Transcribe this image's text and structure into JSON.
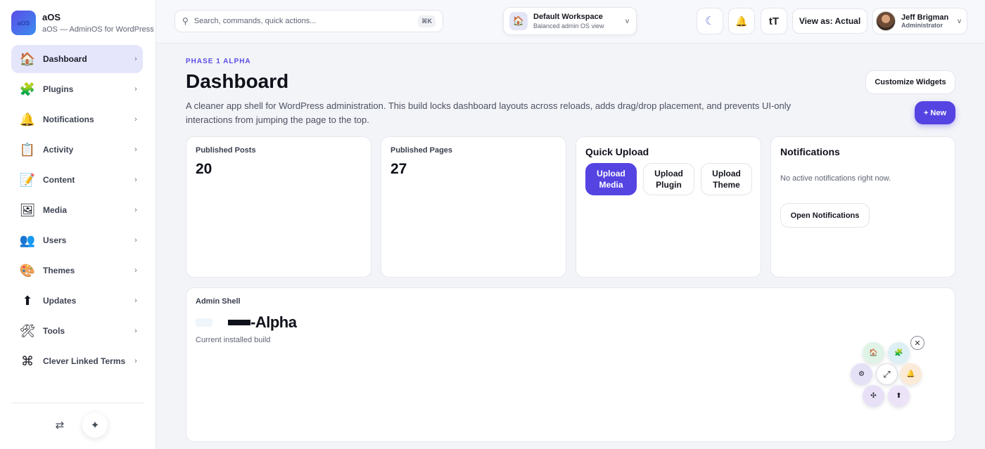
{
  "brand": {
    "logo_text": "aOS",
    "name": "aOS",
    "subtitle": "aOS — AdminOS for WordPress"
  },
  "sidebar": {
    "items": [
      {
        "label": "Dashboard",
        "icon": "🏠",
        "name": "dashboard",
        "active": true
      },
      {
        "label": "Plugins",
        "icon": "🧩",
        "name": "plugins"
      },
      {
        "label": "Notifications",
        "icon": "🔔",
        "name": "notifications"
      },
      {
        "label": "Activity",
        "icon": "📋",
        "name": "activity"
      },
      {
        "label": "Content",
        "icon": "📝",
        "name": "content"
      },
      {
        "label": "Media",
        "icon": "🖼",
        "name": "media"
      },
      {
        "label": "Users",
        "icon": "👥",
        "name": "users"
      },
      {
        "label": "Themes",
        "icon": "🎨",
        "name": "themes"
      },
      {
        "label": "Updates",
        "icon": "⬆",
        "name": "updates"
      },
      {
        "label": "Tools",
        "icon": "🛠",
        "name": "tools"
      },
      {
        "label": "Clever Linked Terms",
        "icon": "⌘",
        "name": "clever-linked-terms"
      }
    ],
    "chevron": "›",
    "footer": {
      "swap_icon": "⇄",
      "sparkle_icon": "✦"
    }
  },
  "topbar": {
    "search_placeholder": "Search, commands, quick actions...",
    "search_icon": "⚲",
    "search_shortcut": "⌘K",
    "workspace": {
      "icon": "🏠",
      "title": "Default Workspace",
      "subtitle": "Balanced admin OS view",
      "chevron": "v"
    },
    "theme_icon": "☾",
    "bell_icon": "🔔",
    "text_size_icon": "tT",
    "view_as": "View as: Actual",
    "user": {
      "name": "Jeff Brigman",
      "role": "Administrator",
      "chevron": "v"
    }
  },
  "page": {
    "eyebrow": "PHASE 1 ALPHA",
    "title": "Dashboard",
    "description": "A cleaner app shell for WordPress administration. This build locks dashboard layouts across reloads, adds drag/drop placement, and prevents UI-only interactions from jumping the page to the top.",
    "customize_label": "Customize Widgets",
    "new_label": "+ New"
  },
  "widgets": {
    "posts": {
      "label": "Published Posts",
      "value": "20"
    },
    "pages": {
      "label": "Published Pages",
      "value": "27"
    },
    "quick_upload": {
      "title": "Quick Upload",
      "buttons": [
        "Upload Media",
        "Upload Plugin",
        "Upload Theme"
      ]
    },
    "notifications": {
      "title": "Notifications",
      "empty": "No active notifications right now.",
      "open_label": "Open Notifications"
    },
    "admin_shell": {
      "label": "Admin Shell",
      "version": "-Alpha",
      "subtitle": "Current installed build"
    }
  },
  "radial_menu": {
    "close_icon": "✕",
    "items": [
      {
        "icon": "🏠",
        "name": "radial-home-button",
        "color": "#dff3e6"
      },
      {
        "icon": "🧩",
        "name": "radial-plugins-button",
        "color": "#dcf0f5"
      },
      {
        "icon": "⚙",
        "name": "radial-settings-button",
        "color": "#e4e1f7"
      },
      {
        "icon": "⤢",
        "name": "radial-expand-button",
        "color": "#ffffff"
      },
      {
        "icon": "🔔",
        "name": "radial-bell-button",
        "color": "#fbead8"
      },
      {
        "icon": "✣",
        "name": "radial-move-button",
        "color": "#e7e0f7"
      },
      {
        "icon": "⬆",
        "name": "radial-updates-button",
        "color": "#ece3f8"
      }
    ]
  },
  "colors": {
    "accent": "#5544e2",
    "active_nav_bg": "#e5e6fb",
    "page_bg": "#f3f4f8"
  }
}
